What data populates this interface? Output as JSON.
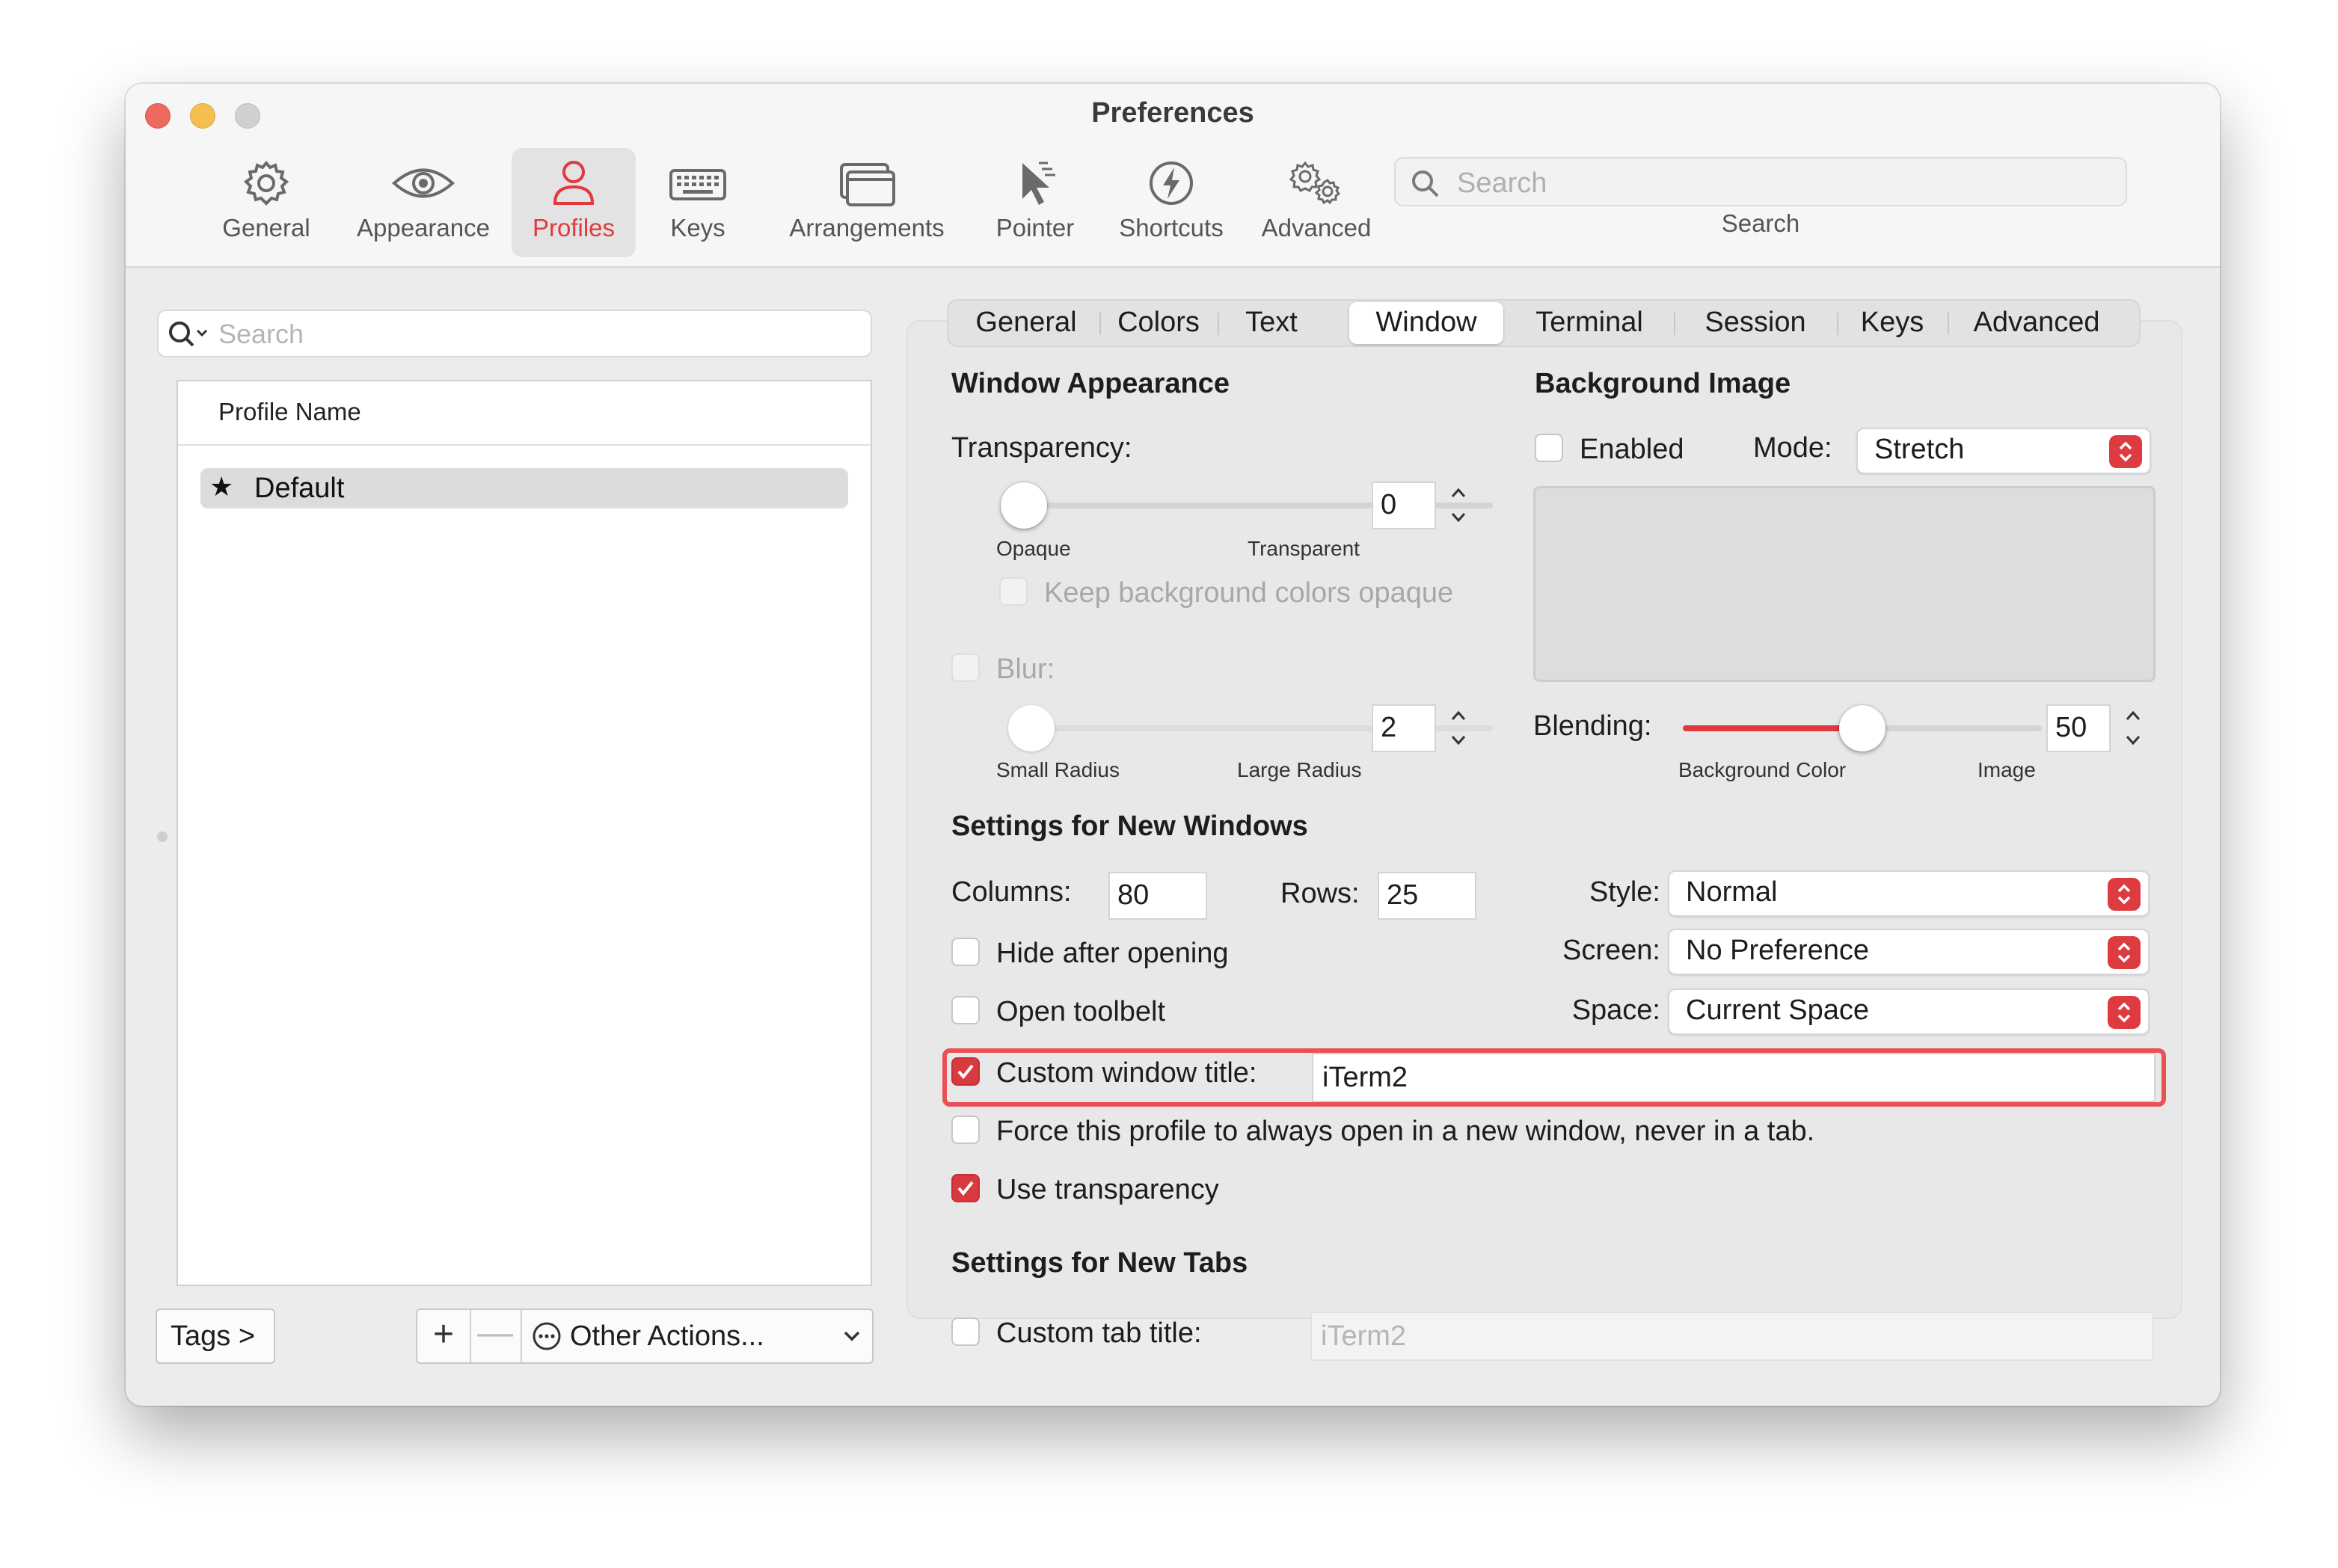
{
  "window": {
    "title": "Preferences",
    "traffic_colors": {
      "close": "#ed6a5e",
      "minimize": "#f5bf4f",
      "zoom": "#d0d0d0"
    }
  },
  "toolbar": {
    "items": [
      {
        "label": "General",
        "icon": "gear-icon"
      },
      {
        "label": "Appearance",
        "icon": "eye-icon"
      },
      {
        "label": "Profiles",
        "icon": "person-icon",
        "active": true
      },
      {
        "label": "Keys",
        "icon": "keyboard-icon"
      },
      {
        "label": "Arrangements",
        "icon": "windows-icon"
      },
      {
        "label": "Pointer",
        "icon": "pointer-icon"
      },
      {
        "label": "Shortcuts",
        "icon": "lightning-icon"
      },
      {
        "label": "Advanced",
        "icon": "gears-icon"
      }
    ],
    "search_placeholder": "Search",
    "search_caption": "Search",
    "accent": "#e0393e"
  },
  "profiles": {
    "search_placeholder": "Search",
    "column_header": "Profile Name",
    "rows": [
      {
        "name": "Default",
        "default": true
      }
    ],
    "tags_label": "Tags >",
    "add_label": "+",
    "remove_label": "—",
    "other_actions_label": "Other Actions..."
  },
  "tabs": {
    "items": [
      "General",
      "Colors",
      "Text",
      "Window",
      "Terminal",
      "Session",
      "Keys",
      "Advanced"
    ],
    "selected": "Window"
  },
  "window_appearance": {
    "title": "Window Appearance",
    "transparency_label": "Transparency:",
    "transparency_value": "0",
    "transparency_min_label": "Opaque",
    "transparency_max_label": "Transparent",
    "keep_bg_opaque_label": "Keep background colors opaque",
    "blur_label": "Blur:",
    "blur_value": "2",
    "blur_min_label": "Small Radius",
    "blur_max_label": "Large Radius"
  },
  "background_image": {
    "title": "Background Image",
    "enabled_label": "Enabled",
    "mode_label": "Mode:",
    "mode_value": "Stretch",
    "blending_label": "Blending:",
    "blending_value": "50",
    "blending_min_label": "Background Color",
    "blending_max_label": "Image"
  },
  "new_windows": {
    "title": "Settings for New Windows",
    "columns_label": "Columns:",
    "columns_value": "80",
    "rows_label": "Rows:",
    "rows_value": "25",
    "hide_after_opening_label": "Hide after opening",
    "open_toolbelt_label": "Open toolbelt",
    "style_label": "Style:",
    "style_value": "Normal",
    "screen_label": "Screen:",
    "screen_value": "No Preference",
    "space_label": "Space:",
    "space_value": "Current Space",
    "custom_title_label": "Custom window title:",
    "custom_title_value": "iTerm2",
    "custom_title_checked": true,
    "force_new_window_label": "Force this profile to always open in a new window, never in a tab.",
    "use_transparency_label": "Use transparency",
    "use_transparency_checked": true
  },
  "new_tabs": {
    "title": "Settings for New Tabs",
    "custom_tab_title_label": "Custom tab title:",
    "custom_tab_title_placeholder": "iTerm2"
  },
  "highlight_color": "#ea5156"
}
